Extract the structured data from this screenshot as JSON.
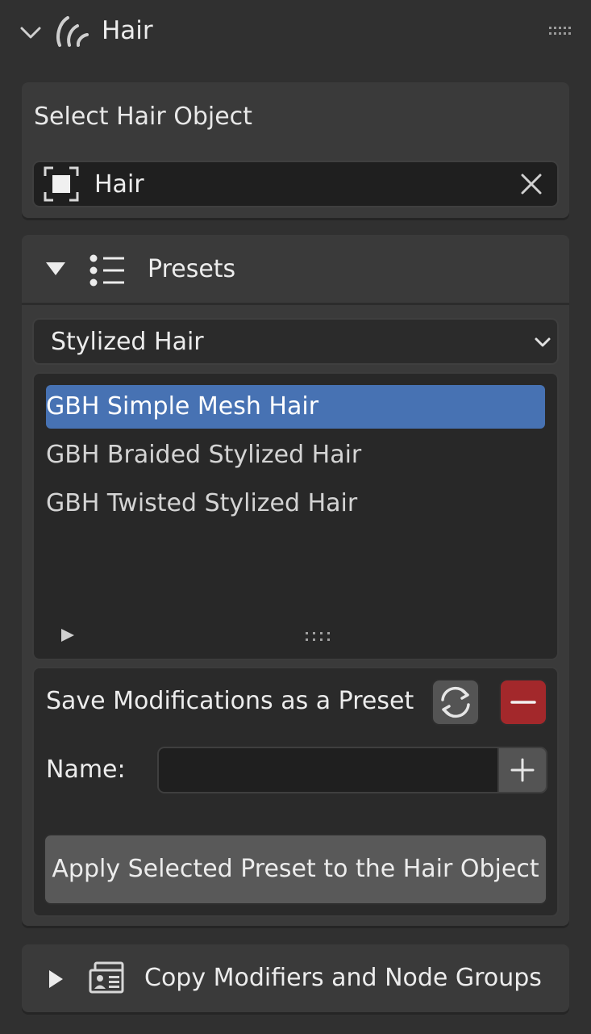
{
  "header": {
    "title": "Hair",
    "icons": {
      "collapse": "chevron-down-icon",
      "panel": "hair-strands-icon",
      "drag": "drag-grip-icon"
    }
  },
  "object_selector": {
    "label": "Select Hair Object",
    "value": "Hair",
    "icons": {
      "object": "object-icon",
      "clear": "close-icon"
    }
  },
  "presets": {
    "title": "Presets",
    "category": "Stylized Hair",
    "items": [
      {
        "label": "GBH Simple Mesh Hair",
        "selected": true
      },
      {
        "label": "GBH Braided Stylized Hair",
        "selected": false
      },
      {
        "label": "GBH Twisted Stylized Hair",
        "selected": false
      }
    ],
    "save_label": "Save Modifications as a Preset",
    "name_label": "Name:",
    "name_value": "",
    "apply_label": "Apply Selected Preset to the Hair Object",
    "colors": {
      "selection": "#4772b3",
      "remove": "#a3282b"
    }
  },
  "copy_section": {
    "title": "Copy Modifiers and Node Groups",
    "icons": {
      "expand": "triangle-right-icon",
      "section": "id-card-icon"
    }
  }
}
